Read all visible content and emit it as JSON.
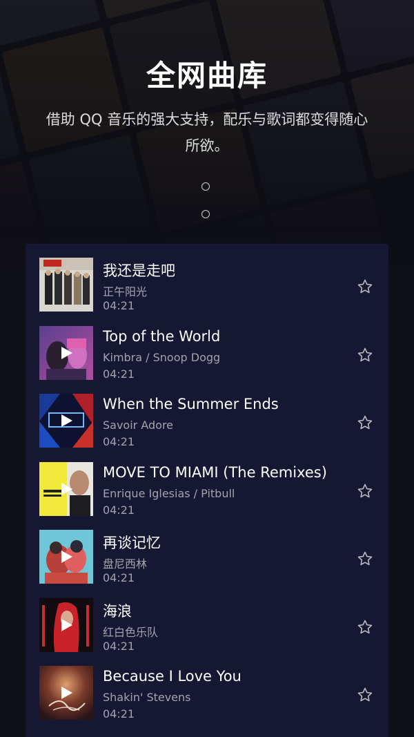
{
  "header": {
    "title": "全网曲库",
    "subtitle": "借助 QQ 音乐的强大支持，配乐与歌词都变得随心所欲。"
  },
  "pager": {
    "count": 2
  },
  "songs": [
    {
      "title": "我还是走吧",
      "artist": "正午阳光",
      "duration": "04:21",
      "cover": "band-photo-cover",
      "playing_icon": false
    },
    {
      "title": "Top of the World",
      "artist": "Kimbra / Snoop Dogg",
      "duration": "04:21",
      "cover": "purple-duo-cover",
      "playing_icon": true
    },
    {
      "title": "When the Summer Ends",
      "artist": "Savoir Adore",
      "duration": "04:21",
      "cover": "unity-blue-red-cover",
      "playing_icon": true
    },
    {
      "title": "MOVE TO MIAMI (The Remixes)",
      "artist": "Enrique Iglesias / Pitbull",
      "duration": "04:21",
      "cover": "yellow-portrait-cover",
      "playing_icon": true
    },
    {
      "title": "再谈记忆",
      "artist": "盘尼西林",
      "duration": "04:21",
      "cover": "cartoon-cyan-cover",
      "playing_icon": true
    },
    {
      "title": "海浪",
      "artist": "红白色乐队",
      "duration": "04:21",
      "cover": "red-hair-cover",
      "playing_icon": true
    },
    {
      "title": "Because I Love You",
      "artist": "Shakin' Stevens",
      "duration": "04:21",
      "cover": "dark-script-cover",
      "playing_icon": true
    }
  ],
  "colors": {
    "panel": "#161733",
    "background": "#101018",
    "text_primary": "#ffffff",
    "text_secondary": "#9c9cab"
  }
}
